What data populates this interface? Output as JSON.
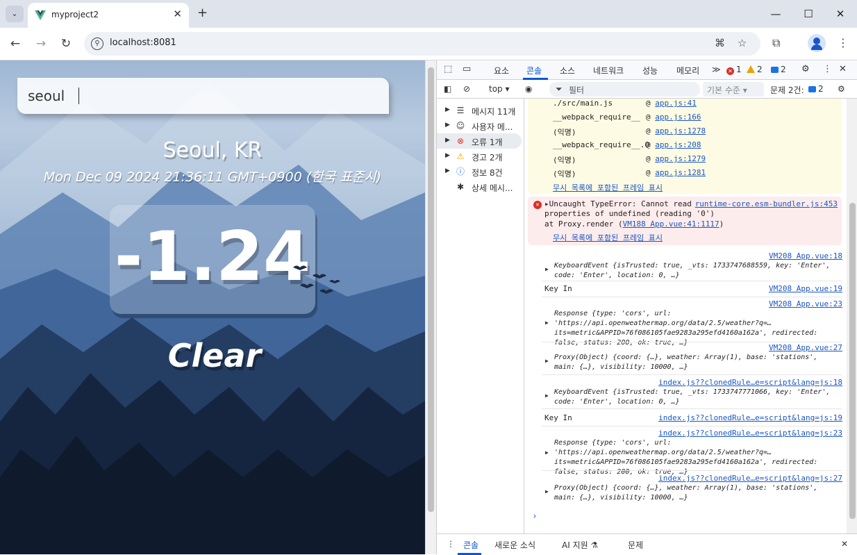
{
  "browser": {
    "tab_title": "myproject2",
    "tab_close": "✕",
    "new_tab": "+",
    "url": "localhost:8081",
    "window_minimize": "—",
    "window_maximize": "☐",
    "window_close": "✕"
  },
  "app": {
    "search_value": "seoul",
    "location": "Seoul, KR",
    "date": "Mon Dec 09 2024 21:36:11 GMT+0900 (한국 표준시)",
    "temperature": "-1.24",
    "weather": "Clear"
  },
  "devtools": {
    "tabs": [
      "요소",
      "콘솔",
      "소스",
      "네트워크",
      "성능",
      "메모리"
    ],
    "active_tab": "콘솔",
    "more": "≫",
    "error_count": "1",
    "warning_count": "2",
    "message_count": "2",
    "context": "top ▾",
    "filter_placeholder": "필터",
    "level": "기본 수준 ▾",
    "issues_label": "문제 2건:",
    "issues_count": "2",
    "sidebar": [
      {
        "label": "메시지 11개",
        "icon": "list-icon"
      },
      {
        "label": "사용자 메...",
        "icon": "user-icon"
      },
      {
        "label": "오류 1개",
        "icon": "error-icon"
      },
      {
        "label": "경고 2개",
        "icon": "warning-icon"
      },
      {
        "label": "정보 8건",
        "icon": "info-icon"
      },
      {
        "label": "상세 메시...",
        "icon": "bug-icon"
      }
    ],
    "stack": [
      {
        "fn": "./src/main.js",
        "src": "app.js:41"
      },
      {
        "fn": "__webpack_require__",
        "src": "app.js:166"
      },
      {
        "fn": "(익명)",
        "src": "app.js:1278"
      },
      {
        "fn": "__webpack_require__.O",
        "src": "app.js:208"
      },
      {
        "fn": "(익명)",
        "src": "app.js:1279"
      },
      {
        "fn": "(익명)",
        "src": "app.js:1281"
      }
    ],
    "show_ignored_frames": "무시 목록에 포함된 프레임 표시",
    "error": {
      "line1": "▸Uncaught TypeError: Cannot read",
      "line2": "properties of undefined (reading '0')",
      "line3_prefix": "    at Proxy.render (",
      "line3_link": "VM188 App.vue:41:1117",
      "line3_suffix": ")",
      "source": "runtime-core.esm-bundler.js:453"
    },
    "logs": [
      {
        "source": "VM208 App.vue:18",
        "text": "",
        "obj": "KeyboardEvent {isTrusted: true, _vts: 1733747688559, key: 'Enter', code: 'Enter', location: 0, …}"
      },
      {
        "source": "VM208 App.vue:19",
        "text": "Key In",
        "obj": ""
      },
      {
        "source": "VM208 App.vue:23",
        "text": "",
        "obj": "Response {type: 'cors', url: 'https://api.openweathermap.org/data/2.5/weather?q=…its=metric&APPID=76f086105fae9283a295efd4160a162a', redirected: false, status: 200, ok: true, …}"
      },
      {
        "source": "VM208 App.vue:27",
        "text": "",
        "obj": "Proxy(Object) {coord: {…}, weather: Array(1), base: 'stations', main: {…}, visibility: 10000, …}"
      },
      {
        "source": "index.js??clonedRule…e=script&lang=js:18",
        "text": "",
        "obj": "KeyboardEvent {isTrusted: true, _vts: 1733747771066, key: 'Enter', code: 'Enter', location: 0, …}"
      },
      {
        "source": "index.js??clonedRule…e=script&lang=js:19",
        "text": "Key In",
        "obj": ""
      },
      {
        "source": "index.js??clonedRule…e=script&lang=js:23",
        "text": "",
        "obj": "Response {type: 'cors', url: 'https://api.openweathermap.org/data/2.5/weather?q=…its=metric&APPID=76f086105fae9283a295efd4160a162a', redirected: false, status: 200, ok: true, …}"
      },
      {
        "source": "index.js??clonedRule…e=script&lang=js:27",
        "text": "",
        "obj": "Proxy(Object) {coord: {…}, weather: Array(1), base: 'stations', main: {…}, visibility: 10000, …}"
      }
    ],
    "prompt": "›",
    "drawer_tabs": [
      "콘솔",
      "새로운 소식",
      "AI 지원 ⚗",
      "문제"
    ]
  },
  "colors": {
    "accent": "#0b57d0",
    "error": "#d93025",
    "warning": "#e8a400",
    "link": "#1a56c4"
  }
}
